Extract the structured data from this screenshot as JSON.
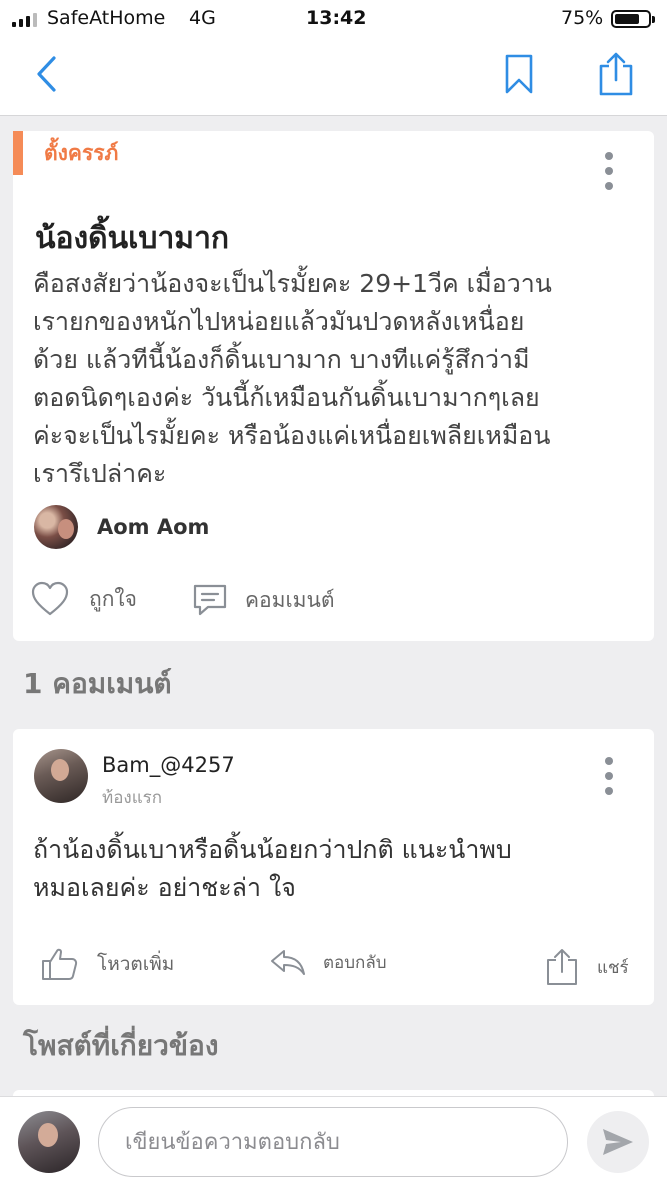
{
  "status_bar": {
    "carrier": "SafeAtHome",
    "network": "4G",
    "time": "13:42",
    "battery_percent": "75%",
    "battery_level": 0.75
  },
  "nav": {
    "icons": [
      "chevron-left-icon",
      "bookmark-icon",
      "share-icon"
    ]
  },
  "post": {
    "category": "ตั้งครรภ์",
    "title": "น้องดิ้นเบามาก",
    "body": "คือสงสัยว่าน้องจะเป็นไรมั้ยคะ 29+1วีค  เมื่อวาน\nเรายกของหนักไปหน่อยแล้วมันปวดหลังเหนื่อย\nด้วย  แล้วทีนี้น้องก็ดิ้นเบามาก บางทีแค่รู้สึกว่ามี\nตอดนิดๆเองค่ะ วันนี้ก้เหมือนกันดิ้นเบามากๆเลย\nค่ะจะเป็นไรมั้ยคะ  หรือน้องแค่เหนื่อยเพลียเหมือน\nเรารึเปล่าคะ",
    "author": "Aom Aom",
    "like_label": "ถูกใจ",
    "comment_label": "คอมเมนต์"
  },
  "comments_heading": "1 คอมเมนต์",
  "comment": {
    "author": "Bam_@4257",
    "badge": "ท้องแรก",
    "text": "ถ้าน้องดิ้นเบาหรือดิ้นน้อยกว่าปกติ แนะนำพบ\nหมอเลยค่ะ อย่าชะล่า ใจ",
    "vote_label": "โหวตเพิ่ม",
    "reply_label": "ตอบกลับ",
    "share_label": "แชร์"
  },
  "related_heading": "โพสต์ที่เกี่ยวข้อง",
  "reply_bar": {
    "placeholder": "เขียนข้อความตอบกลับ"
  },
  "colors": {
    "accent": "#f07a45",
    "link_blue": "#2f8de4",
    "background": "#eeeef0"
  }
}
